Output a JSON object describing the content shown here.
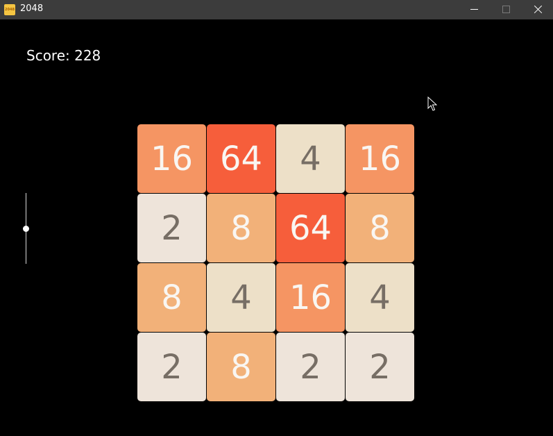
{
  "window": {
    "title": "2048",
    "icon_text": "2048"
  },
  "score": {
    "text": "Score: 228"
  },
  "slider": {
    "level": 0.5
  },
  "board": {
    "rows": [
      [
        16,
        64,
        4,
        16
      ],
      [
        2,
        8,
        64,
        8
      ],
      [
        8,
        4,
        16,
        4
      ],
      [
        2,
        8,
        2,
        2
      ]
    ]
  },
  "tile_colors": {
    "2": {
      "bg": "#eee4da",
      "fg": "#776e65"
    },
    "4": {
      "bg": "#ede0c8",
      "fg": "#776e65"
    },
    "8": {
      "bg": "#f2b179",
      "fg": "#f9f6f2"
    },
    "16": {
      "bg": "#f59563",
      "fg": "#f9f6f2"
    },
    "64": {
      "bg": "#f65e3b",
      "fg": "#f9f6f2"
    }
  },
  "colors": {
    "background": "#000000",
    "titlebar": "#3c3c3c"
  }
}
